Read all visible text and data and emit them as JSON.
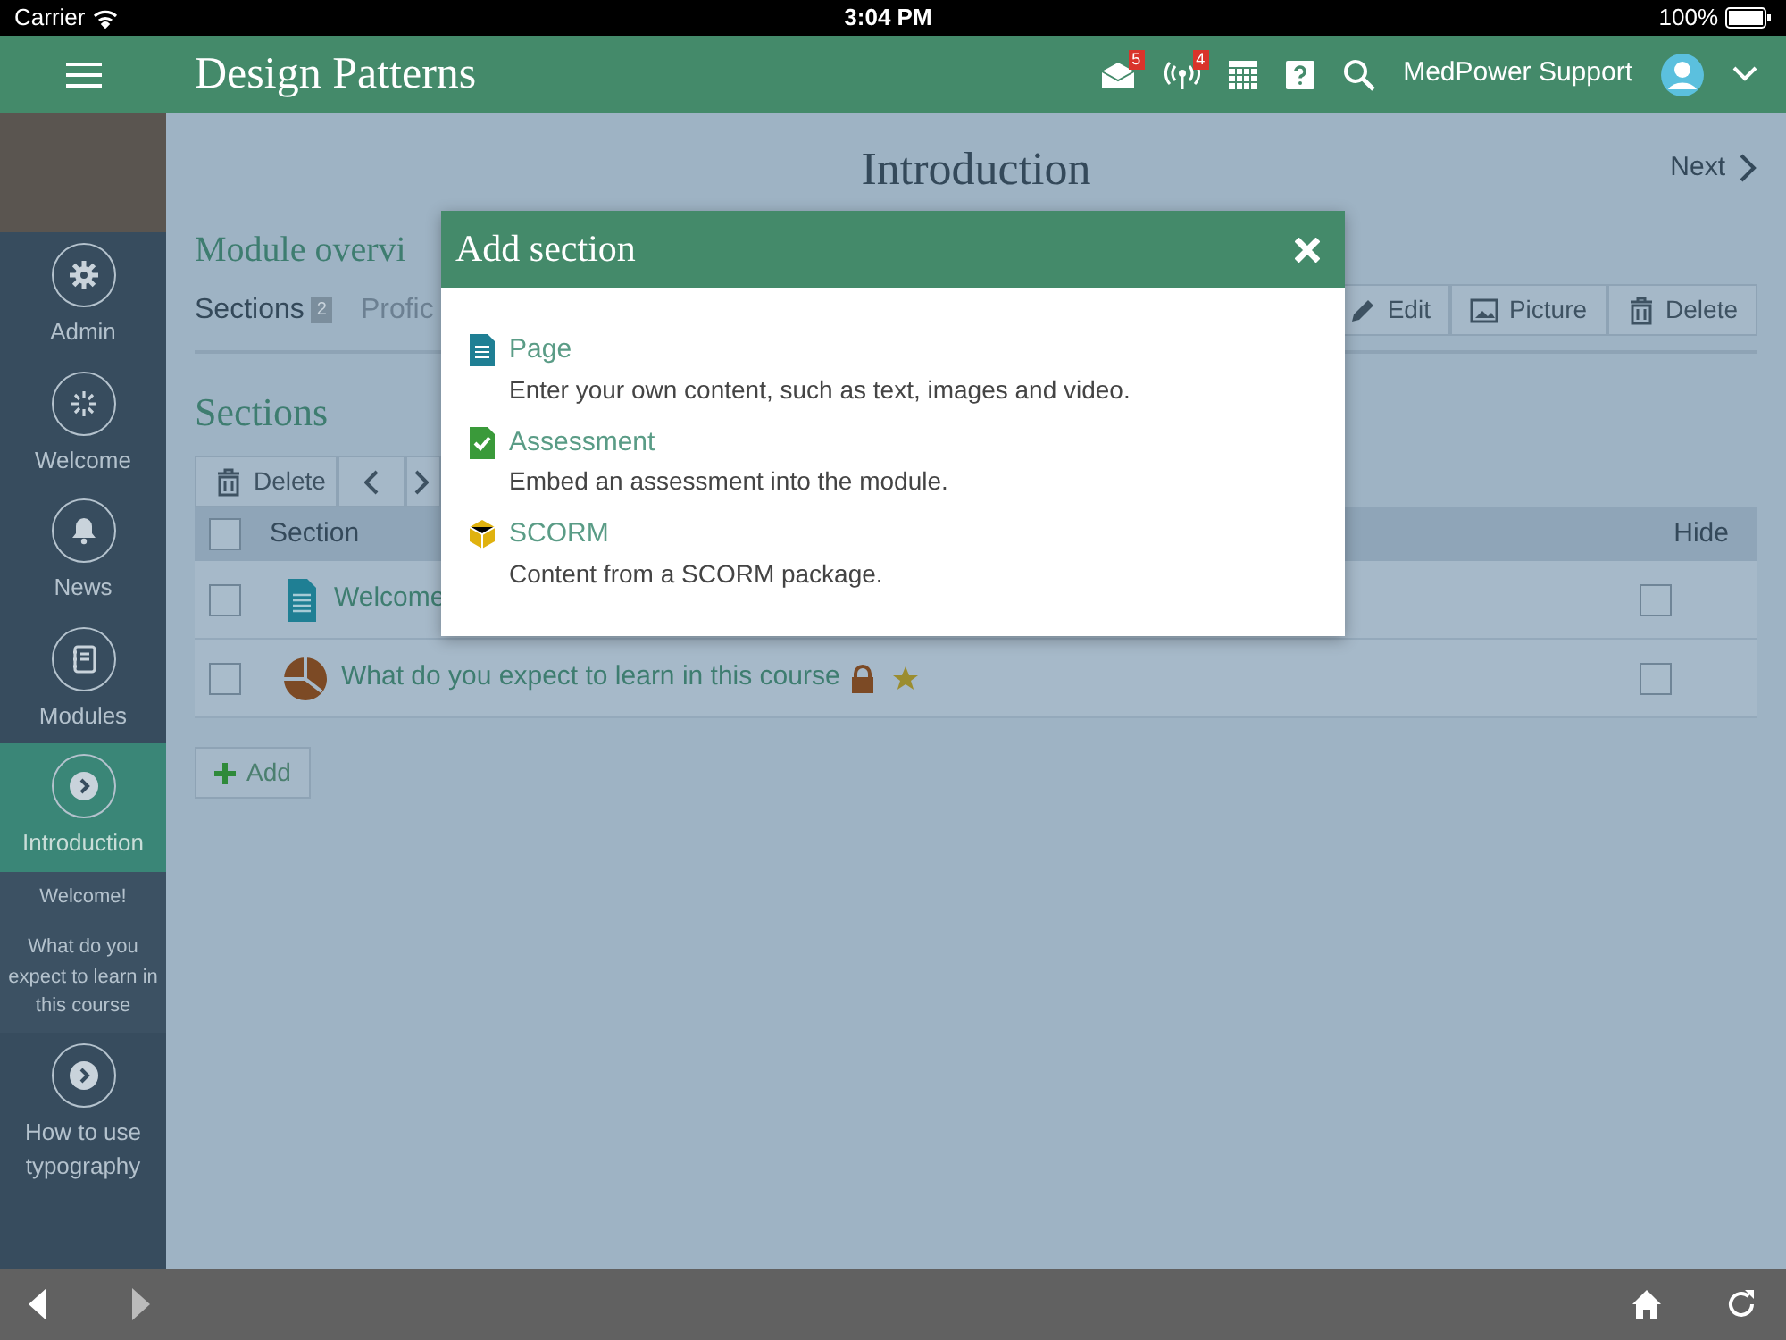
{
  "status_bar": {
    "carrier": "Carrier",
    "time": "3:04 PM",
    "battery": "100%"
  },
  "header": {
    "title": "Design Patterns",
    "mail_count": "5",
    "broadcast_count": "4",
    "user": "MedPower Support"
  },
  "sidebar": {
    "items": [
      {
        "label": "Admin",
        "selected": false
      },
      {
        "label": "Welcome",
        "selected": false
      },
      {
        "label": "News",
        "selected": false
      },
      {
        "label": "Modules",
        "selected": false
      },
      {
        "label": "Introduction",
        "selected": true,
        "children": [
          {
            "label": "Welcome!"
          },
          {
            "label": "What do you expect to learn in this course"
          }
        ]
      },
      {
        "label": "How to use typography",
        "selected": false
      }
    ]
  },
  "page": {
    "title": "Introduction",
    "next": "Next",
    "module_title": "Module overvi",
    "tabs": [
      {
        "label": "Sections",
        "count": "2",
        "selected": true
      },
      {
        "label": "Profic",
        "selected": false
      }
    ],
    "actions": [
      {
        "kind": "edit",
        "label": "Edit"
      },
      {
        "kind": "picture",
        "label": "Picture"
      },
      {
        "kind": "delete",
        "label": "Delete"
      }
    ],
    "sections_heading": "Sections",
    "toolbar_delete": "Delete",
    "table": {
      "select_all": {
        "checked": false
      },
      "columns": [
        "Section",
        "Hide"
      ],
      "rows": [
        {
          "kind": "page",
          "title": "Welcome",
          "selected": false,
          "hidden": false
        },
        {
          "kind": "quiz",
          "title": "What do you expect to learn in this course",
          "selected": false,
          "locked": true,
          "starred": true,
          "hidden": false
        }
      ]
    },
    "add": "Add"
  },
  "modal": {
    "title": "Add section",
    "options": [
      {
        "kind": "page",
        "label": "Page",
        "description": "Enter your own content, such as text, images and video."
      },
      {
        "kind": "assessment",
        "label": "Assessment",
        "description": "Embed an assessment into the module."
      },
      {
        "kind": "scorm",
        "label": "SCORM",
        "description": "Content from a SCORM package."
      }
    ]
  }
}
